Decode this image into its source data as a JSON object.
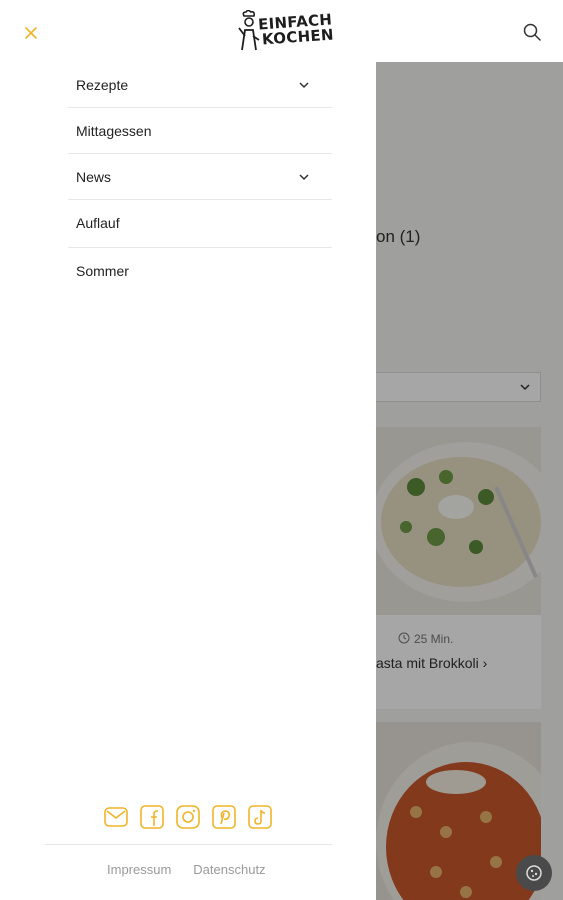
{
  "header": {
    "logo_line1": "EINFACH",
    "logo_line2": "KOCHEN",
    "accent_color": "#f0b429"
  },
  "menu": {
    "items": [
      {
        "label": "Rezepte",
        "has_submenu": true
      },
      {
        "label": "Mittagessen",
        "has_submenu": false
      },
      {
        "label": "News",
        "has_submenu": true
      },
      {
        "label": "Auflauf",
        "has_submenu": false
      },
      {
        "label": "Sommer",
        "has_submenu": false
      }
    ]
  },
  "social": [
    "mail-icon",
    "facebook-icon",
    "instagram-icon",
    "pinterest-icon",
    "tiktok-icon"
  ],
  "footer": {
    "impressum": "Impressum",
    "datenschutz": "Datenschutz"
  },
  "background": {
    "title_fragment": "on (1)",
    "card1_time": "25 Min.",
    "card1_title": "asta mit Brokkoli"
  }
}
